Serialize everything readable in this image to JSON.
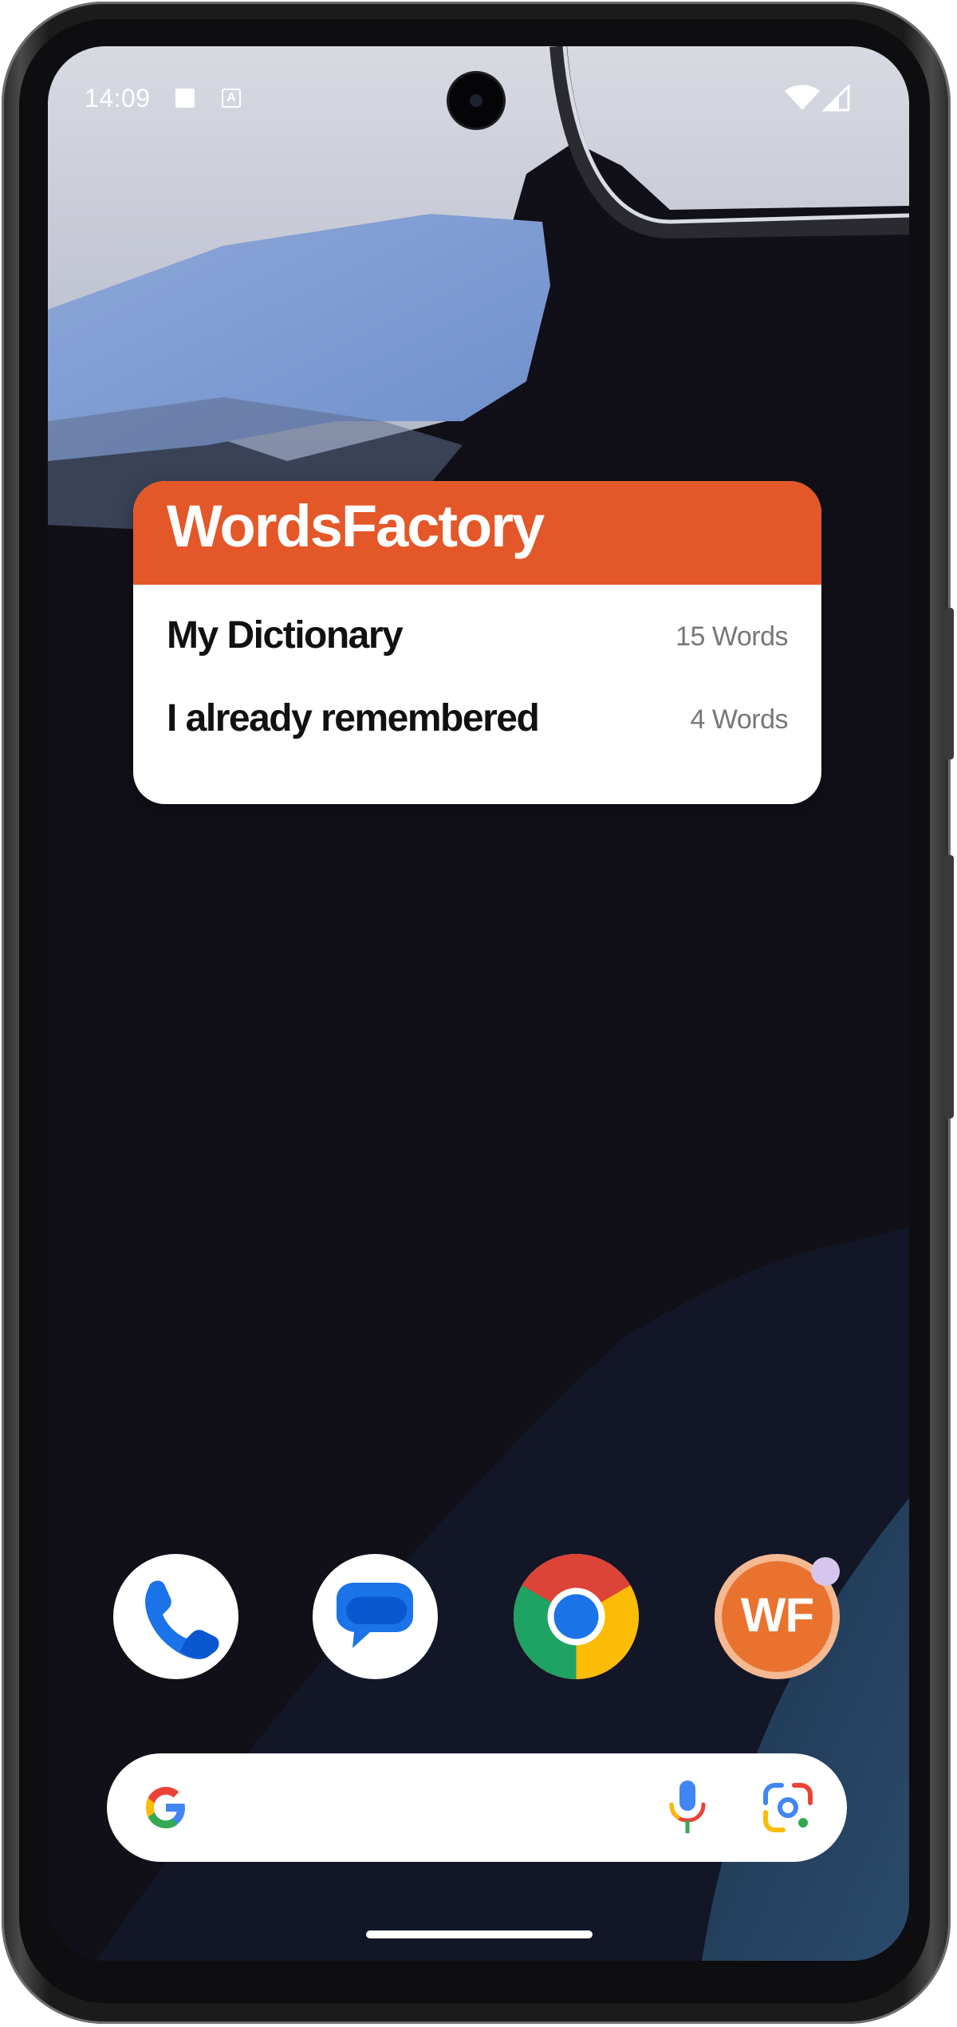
{
  "status_bar": {
    "time": "14:09",
    "notification_icon_letter": "A"
  },
  "widget": {
    "title": "WordsFactory",
    "rows": [
      {
        "label": "My Dictionary",
        "count": "15 Words"
      },
      {
        "label": "I already remembered",
        "count": "4 Words"
      }
    ],
    "accent_color": "#e35728"
  },
  "dock": {
    "apps": [
      {
        "name": "Phone",
        "icon": "phone-icon"
      },
      {
        "name": "Messages",
        "icon": "messages-icon"
      },
      {
        "name": "Chrome",
        "icon": "chrome-icon"
      },
      {
        "name": "WordsFactory",
        "icon": "wordsfactory-icon",
        "icon_text": "WF"
      }
    ]
  },
  "search_bar": {
    "icons": [
      "google-g-icon",
      "microphone-icon",
      "google-lens-icon"
    ]
  }
}
